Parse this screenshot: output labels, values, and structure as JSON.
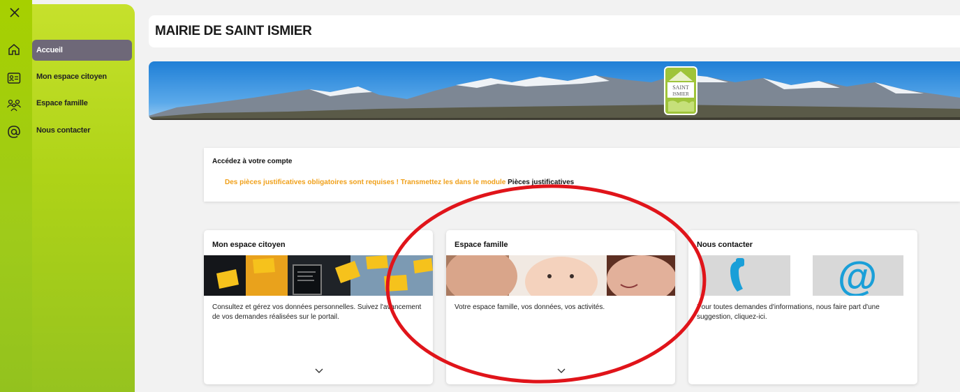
{
  "rail": {
    "icons": [
      "close-icon",
      "home-icon",
      "id-card-icon",
      "family-icon",
      "at-icon"
    ]
  },
  "sidebar": {
    "items": [
      {
        "label": "Accueil",
        "active": true
      },
      {
        "label": "Mon espace citoyen"
      },
      {
        "label": "Espace famille"
      },
      {
        "label": "Nous contacter"
      }
    ]
  },
  "header": {
    "title": "MAIRIE DE SAINT ISMIER"
  },
  "banner": {
    "logo_text_1": "SAINT",
    "logo_text_2": "ISMIER"
  },
  "account": {
    "title": "Accédez à votre compte",
    "message": "Des pièces justificatives obligatoires sont requises ! Transmettez les dans le module ",
    "message_link": "Pièces justificatives"
  },
  "cards": [
    {
      "title": "Mon espace citoyen",
      "description": "Consultez et gérez vos données personnelles. Suivez l'avancement de vos demandes réalisées sur le portail."
    },
    {
      "title": "Espace famille",
      "description": "Votre espace famille, vos données, vos activités."
    },
    {
      "title": "Nous contacter",
      "description": "Pour toutes demandes d'informations, nous faire part d'une suggestion, cliquez-ici."
    }
  ],
  "colors": {
    "brand_green": "#a6d000",
    "active_item": "#6e6878",
    "warning_text": "#f0a01a",
    "annotation": "#e0141a"
  }
}
